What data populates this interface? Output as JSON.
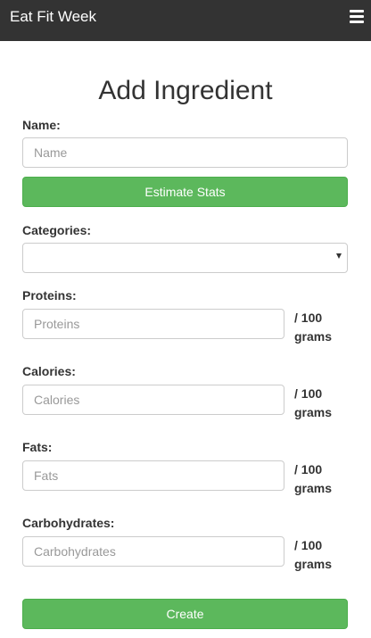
{
  "navbar": {
    "brand": "Eat Fit Week",
    "menu_icon": "hamburger-menu-icon"
  },
  "page": {
    "title": "Add Ingredient"
  },
  "form": {
    "name": {
      "label": "Name:",
      "placeholder": "Name",
      "value": ""
    },
    "estimate_button": "Estimate Stats",
    "categories": {
      "label": "Categories:",
      "selected": ""
    },
    "proteins": {
      "label": "Proteins:",
      "placeholder": "Proteins",
      "value": "",
      "unit": "/ 100 grams"
    },
    "calories": {
      "label": "Calories:",
      "placeholder": "Calories",
      "value": "",
      "unit": "/ 100 grams"
    },
    "fats": {
      "label": "Fats:",
      "placeholder": "Fats",
      "value": "",
      "unit": "/ 100 grams"
    },
    "carbohydrates": {
      "label": "Carbohydrates:",
      "placeholder": "Carbohydrates",
      "value": "",
      "unit": "/ 100 grams"
    },
    "create_button": "Create"
  },
  "colors": {
    "navbar_bg": "#333333",
    "button_green": "#5cb85c",
    "button_border": "#4cae4c"
  }
}
